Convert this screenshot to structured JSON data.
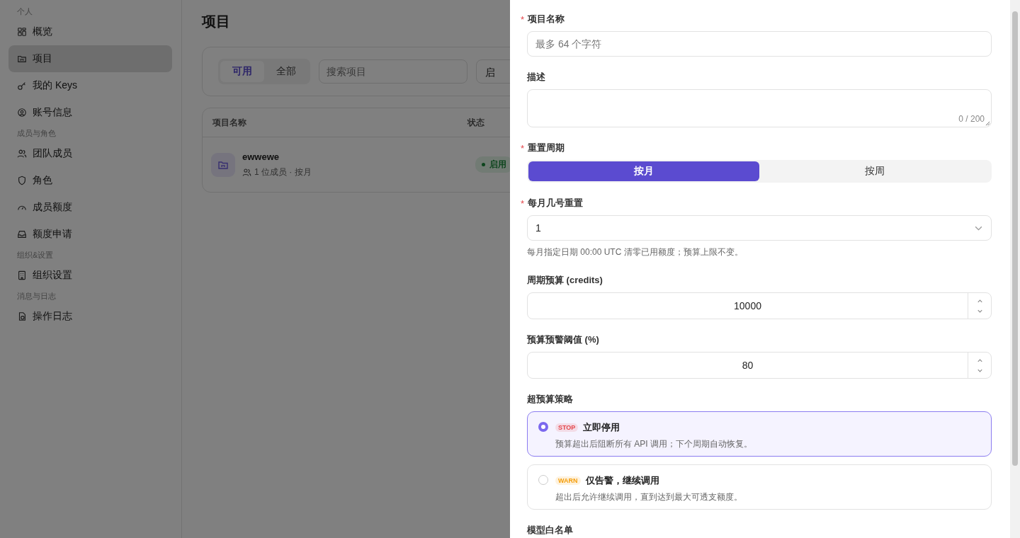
{
  "sidebar": {
    "sections": [
      {
        "title": "个人",
        "items": [
          {
            "label": "概览",
            "selected": false
          },
          {
            "label": "项目",
            "selected": true
          },
          {
            "label": "我的 Keys",
            "selected": false
          },
          {
            "label": "账号信息",
            "selected": false
          }
        ]
      },
      {
        "title": "成员与角色",
        "items": [
          {
            "label": "团队成员",
            "selected": false
          },
          {
            "label": "角色",
            "selected": false
          },
          {
            "label": "成员额度",
            "selected": false
          },
          {
            "label": "额度申请",
            "selected": false
          }
        ]
      },
      {
        "title": "组织&设置",
        "items": [
          {
            "label": "组织设置",
            "selected": false
          }
        ]
      },
      {
        "title": "消息与日志",
        "items": [
          {
            "label": "操作日志",
            "selected": false
          }
        ]
      }
    ]
  },
  "page": {
    "title": "项目",
    "filter_tabs": [
      {
        "label": "可用",
        "selected": true
      },
      {
        "label": "全部",
        "selected": false
      }
    ],
    "search": {
      "placeholder": "搜索项目"
    },
    "status_select": {
      "value": "启"
    },
    "table": {
      "columns": [
        "项目名称",
        "状态"
      ],
      "rows": [
        {
          "name": "ewwewe",
          "meta": "1 位成员 · 按月",
          "status": "启用"
        }
      ]
    }
  },
  "drawer": {
    "fields": [
      {
        "kind": "text",
        "label": "项目名称",
        "marker": "*",
        "placeholder": "最多 64 个字符"
      },
      {
        "kind": "textarea",
        "label": "描述",
        "counter": "0 / 200"
      },
      {
        "kind": "segmented",
        "label": "重置周期",
        "marker": "*",
        "options": [
          {
            "label": "按月",
            "selected": true
          },
          {
            "label": "按周",
            "selected": false
          }
        ]
      },
      {
        "kind": "select",
        "label": "每月几号重置",
        "marker": "*",
        "value": "1",
        "hint": "每月指定日期 00:00 UTC 清零已用额度；预算上限不变。"
      },
      {
        "kind": "number",
        "label": "周期预算 (credits)",
        "value": "10000"
      },
      {
        "kind": "number",
        "label": "预算预警阈值 (%)",
        "value": "80"
      },
      {
        "kind": "radio-cards",
        "label": "超预算策略",
        "options": [
          {
            "badge": "STOP",
            "color": "#e5484d",
            "title": "立即停用",
            "description": "预算超出后阻断所有 API 调用；下个周期自动恢复。",
            "selected": true
          },
          {
            "badge": "WARN",
            "color": "#f59e0b",
            "title": "仅告警，继续调用",
            "description": "超出后允许继续调用，直到达到最大可透支额度。",
            "selected": false
          }
        ]
      },
      {
        "kind": "heading",
        "label": "模型白名单"
      }
    ]
  }
}
